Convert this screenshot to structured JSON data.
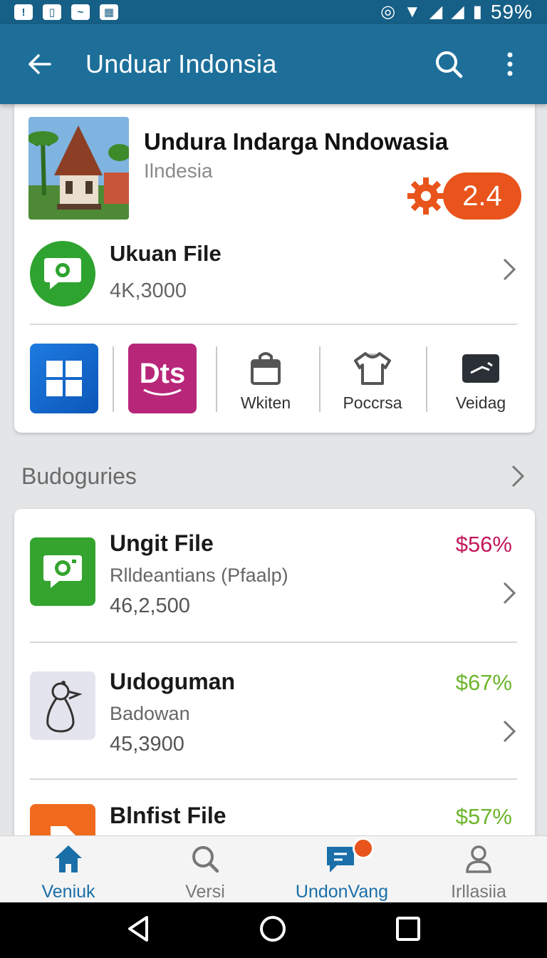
{
  "status_bar": {
    "battery_text": "59%"
  },
  "app_bar": {
    "title": "Unduar Indonsia"
  },
  "hero": {
    "title": "Undura Indarga Nndowasia",
    "subtitle": "Ilndesia",
    "rating": "2.4"
  },
  "file": {
    "title": "Ukuan File",
    "size": "4K,3000"
  },
  "apps": [
    {
      "label": "Wkiten"
    },
    {
      "label": "Poccrsa"
    },
    {
      "label": "Veidag"
    }
  ],
  "tile_dts_text": "Dts",
  "section": {
    "title": "Budoguries"
  },
  "list": [
    {
      "title": "Ungit File",
      "subtitle": "Rlldeantians (Pfaalp)",
      "size": "46,2,500",
      "price": "$56%",
      "price_color": "#c2185b"
    },
    {
      "title": "Uıdoguman",
      "subtitle": "Badowan",
      "size": "45,3900",
      "price": "$67%",
      "price_color": "#6cb52d"
    },
    {
      "title": "Blnfist File",
      "subtitle": "",
      "size": "",
      "price": "$57%",
      "price_color": "#6cb52d"
    }
  ],
  "bottom_nav": [
    {
      "label": "Veniuk",
      "active": true
    },
    {
      "label": "Versi",
      "active": false
    },
    {
      "label": "UndonVang",
      "active": true
    },
    {
      "label": "Irllasiia",
      "active": false
    }
  ],
  "colors": {
    "app_bar": "#1d6f9a",
    "status_bar": "#165f86",
    "accent_orange": "#e8541c",
    "nav_active": "#1a6fa8"
  }
}
